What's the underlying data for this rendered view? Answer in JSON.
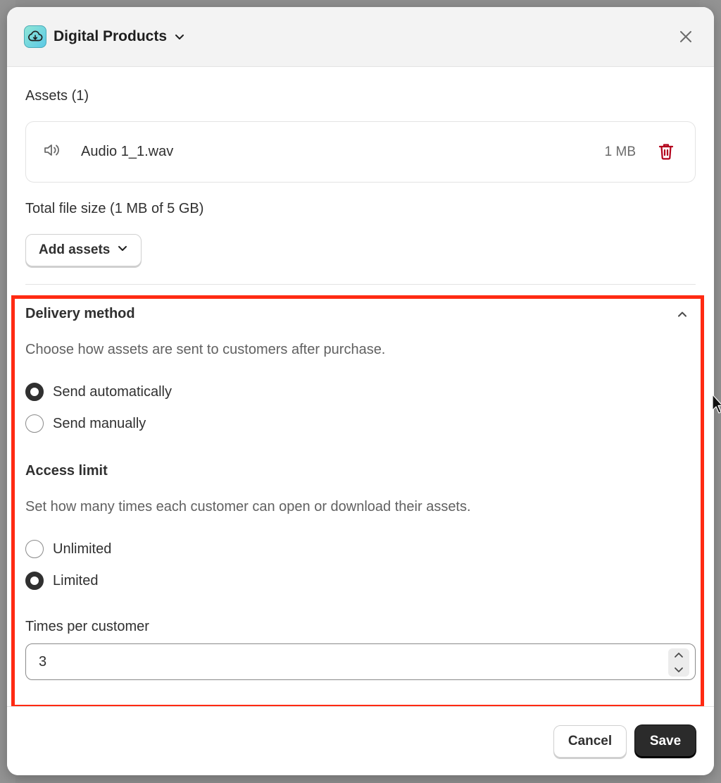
{
  "header": {
    "title": "Digital Products"
  },
  "assets": {
    "heading": "Assets (1)",
    "items": [
      {
        "name": "Audio 1_1.wav",
        "size": "1 MB",
        "icon": "speaker-icon"
      }
    ],
    "total_size": "Total file size (1 MB of 5 GB)",
    "add_label": "Add assets"
  },
  "delivery": {
    "title": "Delivery method",
    "description": "Choose how assets are sent to customers after purchase.",
    "options": [
      {
        "label": "Send automatically",
        "checked": true
      },
      {
        "label": "Send manually",
        "checked": false
      }
    ]
  },
  "access": {
    "title": "Access limit",
    "description": "Set how many times each customer can open or download their assets.",
    "options": [
      {
        "label": "Unlimited",
        "checked": false
      },
      {
        "label": "Limited",
        "checked": true
      }
    ],
    "times_label": "Times per customer",
    "times_value": "3"
  },
  "footer": {
    "cancel_label": "Cancel",
    "save_label": "Save"
  },
  "colors": {
    "highlight": "#ff2a12",
    "primary_button": "#2b2b2b",
    "delete_icon": "#b3001b"
  }
}
